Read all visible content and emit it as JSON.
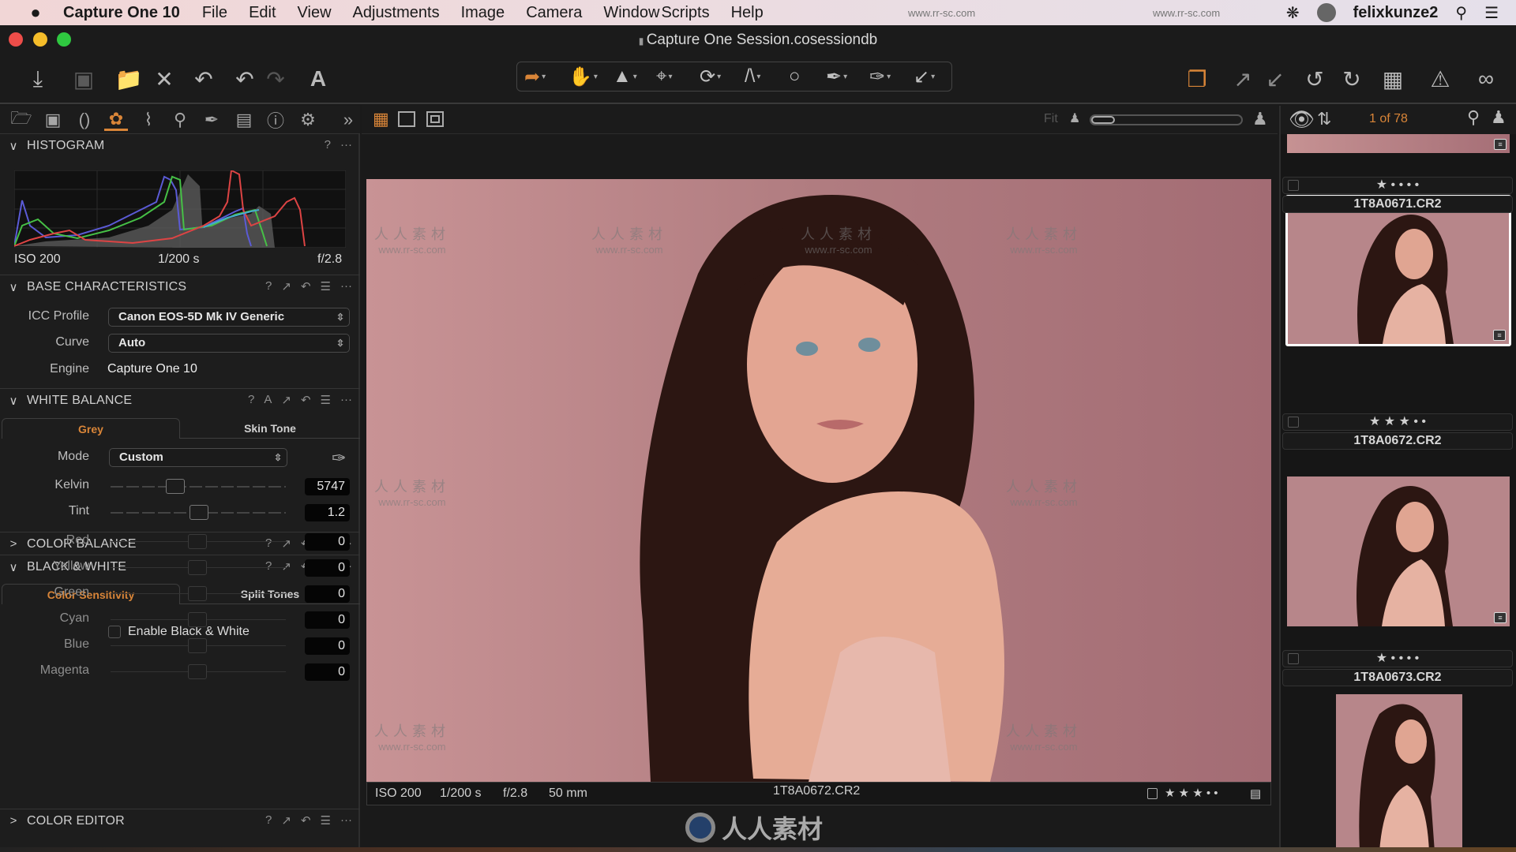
{
  "menubar": {
    "apple": "",
    "app_name": "Capture One 10",
    "items": [
      "File",
      "Edit",
      "View",
      "Adjustments",
      "Image",
      "Camera",
      "Window",
      "Scripts",
      "Help"
    ],
    "username": "felixkunze2",
    "watermark": "www.rr-sc.com"
  },
  "window": {
    "title": "Capture One Session.cosessiondb",
    "traffic_lights": {
      "close": "#ed4d49",
      "minimize": "#f5bd2a",
      "zoom": "#2fc840"
    }
  },
  "toolbar": {
    "left_icons": [
      "import-icon",
      "camera-icon",
      "move-to-folder-icon",
      "delete-icon",
      "undo-all-icon",
      "undo-icon",
      "redo-icon",
      "auto-adjust-icon"
    ],
    "cursor_tools": [
      "select-tool",
      "pan-tool",
      "keystone-tool",
      "crop-tool",
      "rotate-tool",
      "straighten-tool",
      "circle-mask-tool",
      "brush-tool",
      "color-picker-tool",
      "annotation-tool"
    ],
    "right_icons": [
      "variants-icon",
      "copy-adjustments-icon",
      "apply-adjustments-icon",
      "rotate-left-icon",
      "rotate-right-icon",
      "grid-icon",
      "exposure-warning-icon",
      "proof-glasses-icon"
    ],
    "accent_color": "#d98538"
  },
  "tool_tabs": {
    "items": [
      "library",
      "capture",
      "lens",
      "color",
      "exposure",
      "details",
      "local-adjustments",
      "metadata",
      "output-info",
      "settings"
    ],
    "active_index": 3,
    "more": "»"
  },
  "histogram": {
    "title": "HISTOGRAM",
    "iso": "ISO 200",
    "shutter": "1/200 s",
    "aperture": "f/2.8"
  },
  "base_characteristics": {
    "title": "BASE CHARACTERISTICS",
    "icc_label": "ICC Profile",
    "icc_value": "Canon EOS-5D Mk IV Generic",
    "curve_label": "Curve",
    "curve_value": "Auto",
    "engine_label": "Engine",
    "engine_value": "Capture One 10"
  },
  "white_balance": {
    "title": "WHITE BALANCE",
    "tabs": [
      "Grey",
      "Skin Tone"
    ],
    "mode_label": "Mode",
    "mode_value": "Custom",
    "kelvin_label": "Kelvin",
    "kelvin_value": "5747",
    "kelvin_position": 0.37,
    "tint_label": "Tint",
    "tint_value": "1.2",
    "tint_position": 0.51
  },
  "color_balance": {
    "title": "COLOR BALANCE"
  },
  "black_white": {
    "title": "BLACK & WHITE",
    "tabs": [
      "Color Sensitivity",
      "Split Tones"
    ],
    "enable_label": "Enable Black & White",
    "enabled": false,
    "channels": [
      {
        "label": "Red",
        "value": "0"
      },
      {
        "label": "Yellow",
        "value": "0"
      },
      {
        "label": "Green",
        "value": "0"
      },
      {
        "label": "Cyan",
        "value": "0"
      },
      {
        "label": "Blue",
        "value": "0"
      },
      {
        "label": "Magenta",
        "value": "0"
      }
    ]
  },
  "color_editor": {
    "title": "COLOR EDITOR"
  },
  "viewer": {
    "zoom_label": "Fit",
    "info": {
      "iso": "ISO 200",
      "shutter": "1/200 s",
      "aperture": "f/2.8",
      "focal": "50 mm"
    },
    "filename": "1T8A0672.CR2",
    "rating": 3,
    "rating_display": "★ ★ ★ • •",
    "watermark_cn": "人人素材",
    "watermark_url": "www.rr-sc.com"
  },
  "browser": {
    "counter": "1 of 78",
    "items": [
      {
        "filename": "1T8A0671.CR2",
        "rating": 1,
        "rating_display": "★ • • • •",
        "selected": false
      },
      {
        "filename": "1T8A0672.CR2",
        "rating": 3,
        "rating_display": "★ ★ ★ • •",
        "selected": true
      },
      {
        "filename": "1T8A0673.CR2",
        "rating": 1,
        "rating_display": "★ • • • •",
        "selected": false
      }
    ]
  },
  "footer_logo": "人人素材"
}
